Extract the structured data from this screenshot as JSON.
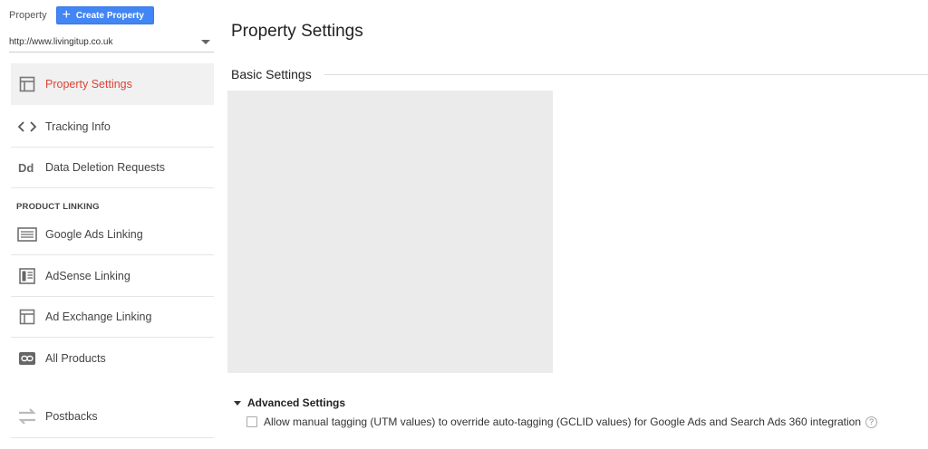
{
  "header": {
    "property_label": "Property",
    "create_button_label": "Create Property",
    "property_url": "http://www.livingitup.co.uk"
  },
  "sidebar": {
    "items": [
      {
        "label": "Property Settings",
        "icon": "layout-icon",
        "active": true
      },
      {
        "label": "Tracking Info",
        "icon": "code-icon"
      },
      {
        "label": "Data Deletion Requests",
        "icon": "dd-icon"
      }
    ],
    "product_linking_header": "PRODUCT LINKING",
    "linking_items": [
      {
        "label": "Google Ads Linking",
        "icon": "ads-icon"
      },
      {
        "label": "AdSense Linking",
        "icon": "adsense-icon"
      },
      {
        "label": "Ad Exchange Linking",
        "icon": "ad-exchange-icon"
      },
      {
        "label": "All Products",
        "icon": "link-icon"
      }
    ],
    "postbacks_label": "Postbacks"
  },
  "main": {
    "page_title": "Property Settings",
    "basic_settings_title": "Basic Settings",
    "advanced_settings_title": "Advanced Settings",
    "manual_tagging_label": "Allow manual tagging (UTM values) to override auto-tagging (GCLID values) for Google Ads and Search Ads 360 integration",
    "manual_tagging_checked": false,
    "help_glyph": "?"
  },
  "colors": {
    "accent_blue": "#4285f4",
    "active_red": "#db4437",
    "placeholder_gray": "#ebebeb"
  }
}
